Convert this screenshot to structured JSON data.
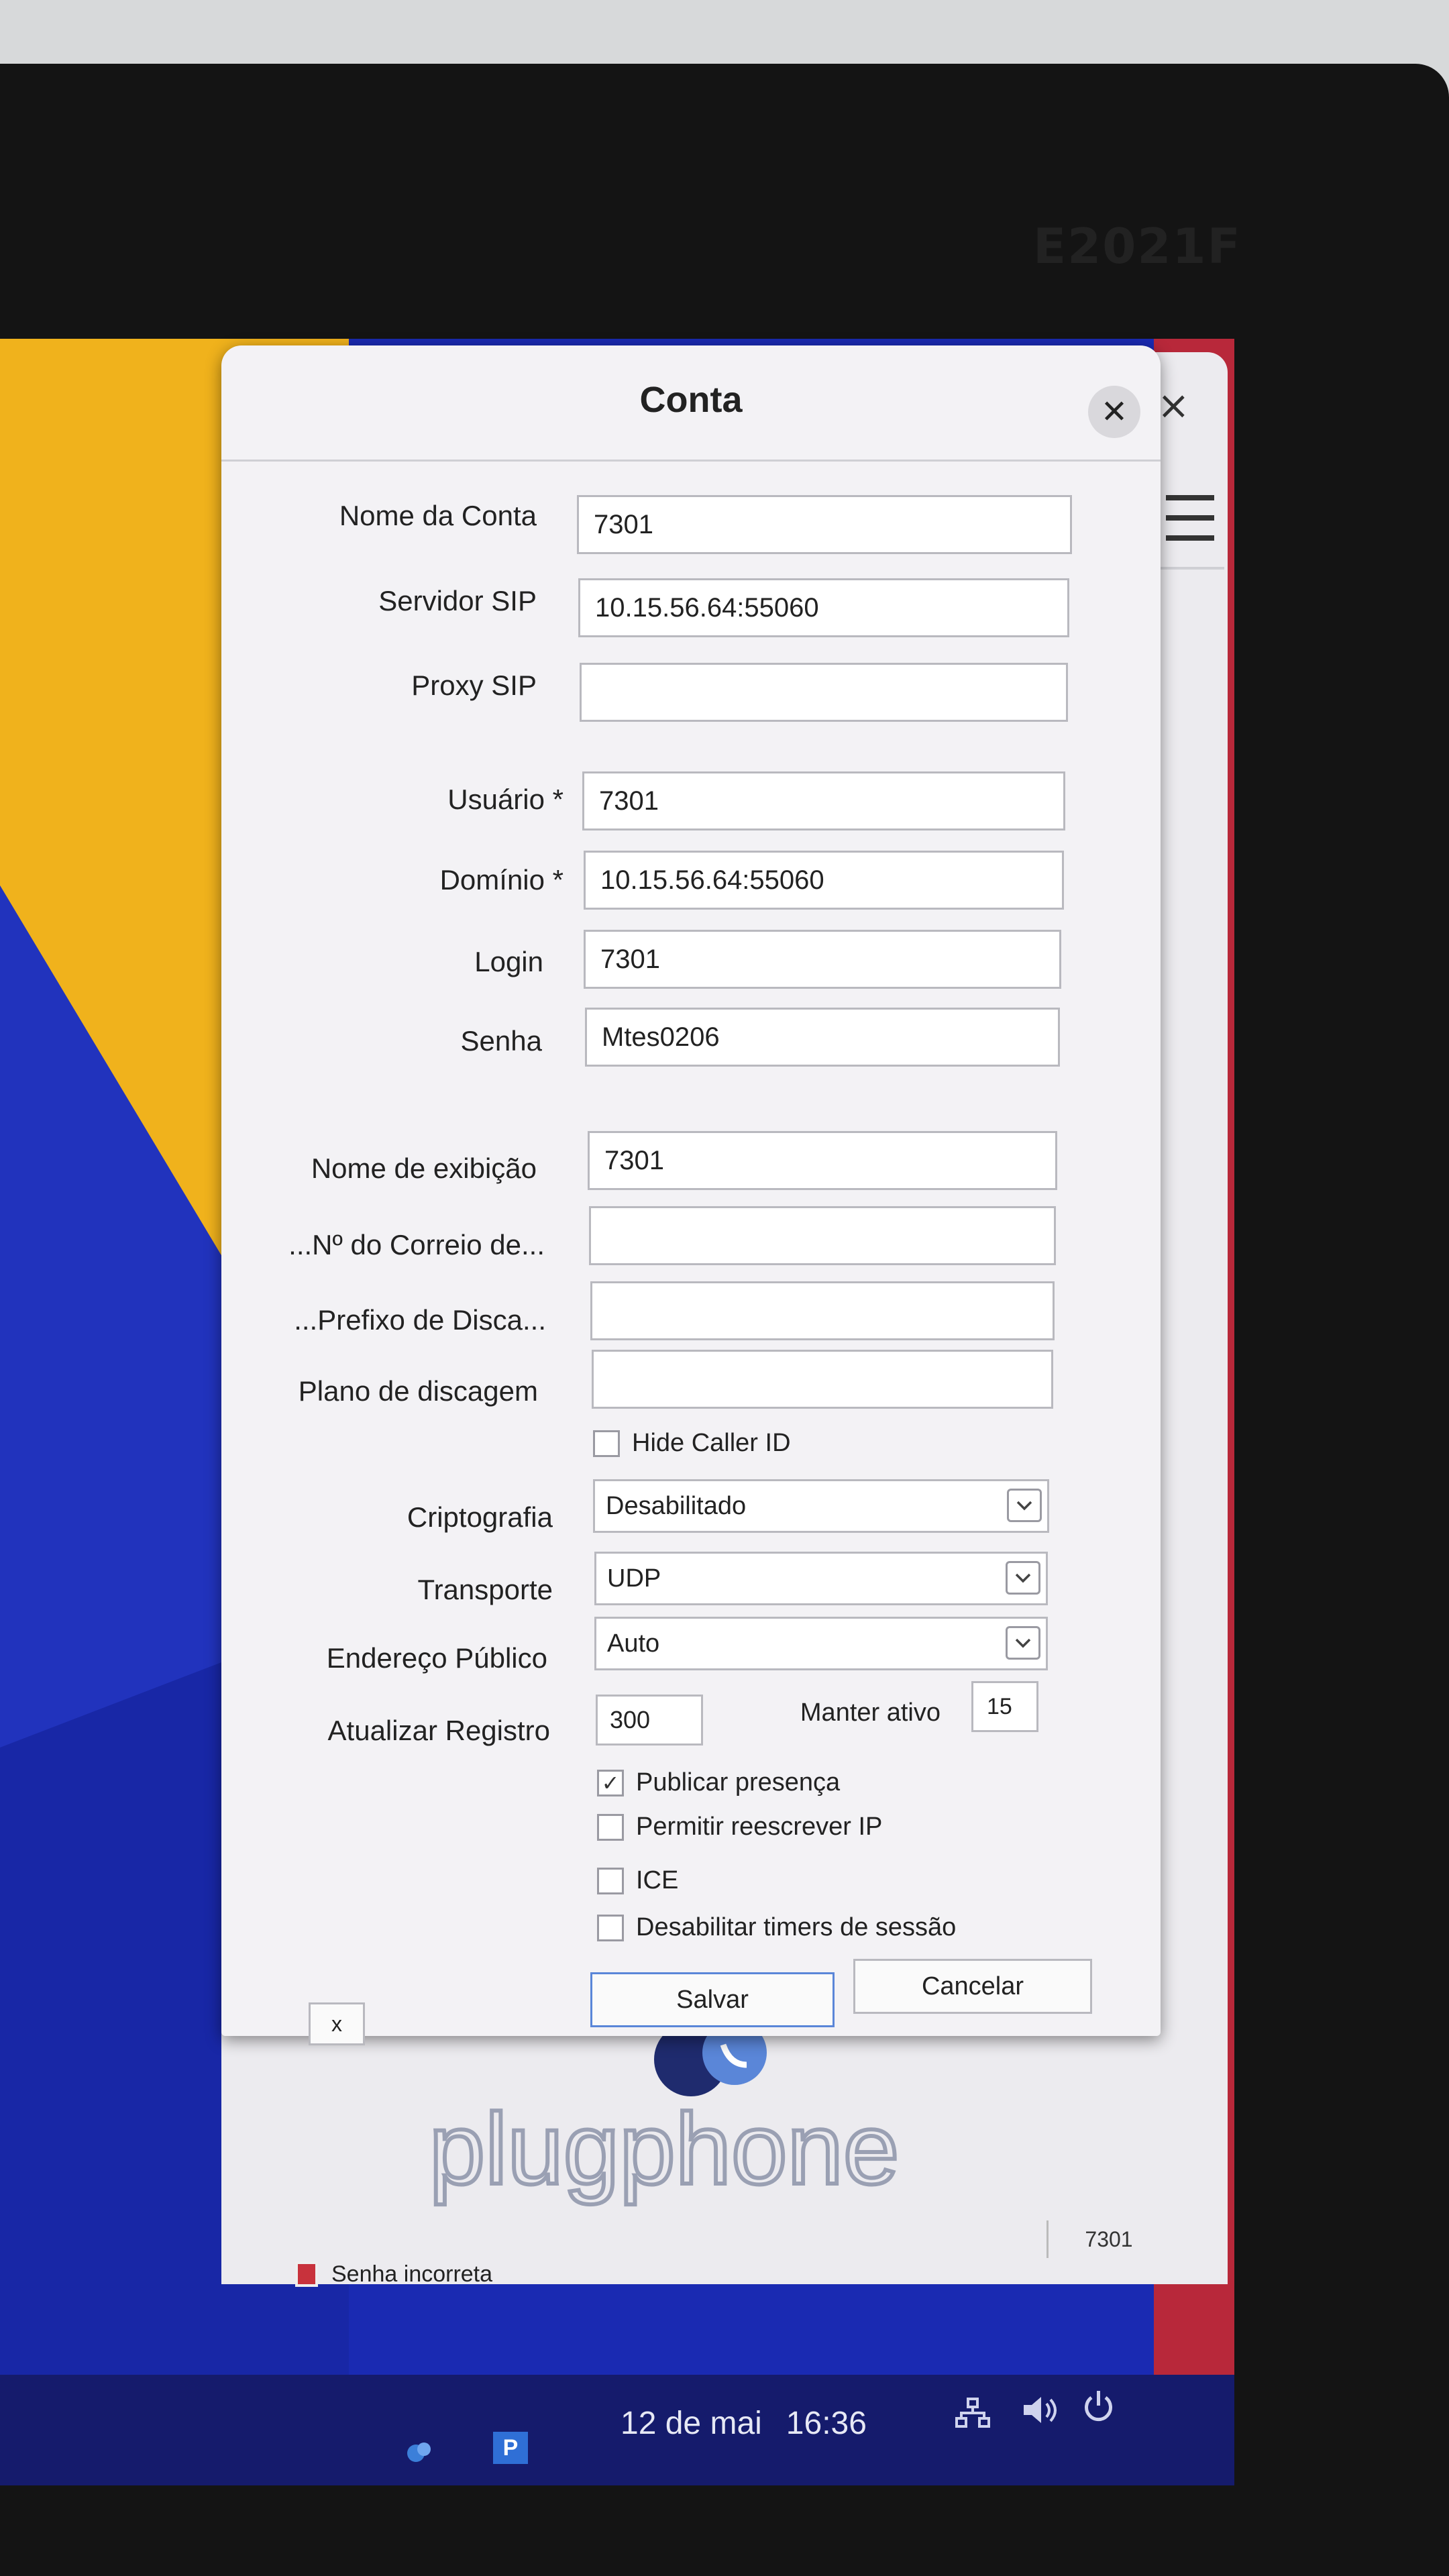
{
  "monitor": {
    "brand": "E2021F"
  },
  "dialog": {
    "title": "Conta",
    "close_glyph": "✕",
    "fields": [
      {
        "label": "Nome da Conta",
        "value": "7301"
      },
      {
        "label": "Servidor SIP",
        "value": "10.15.56.64:55060"
      },
      {
        "label": "Proxy SIP",
        "value": ""
      },
      {
        "label": "Usuário *",
        "value": "7301"
      },
      {
        "label": "Domínio *",
        "value": "10.15.56.64:55060"
      },
      {
        "label": "Login",
        "value": "7301"
      },
      {
        "label": "Senha",
        "value": "Mtes0206"
      },
      {
        "label": "Nome de exibição",
        "value": "7301"
      },
      {
        "label": "...Nº do Correio de...",
        "value": ""
      },
      {
        "label": "...Prefixo de Disca...",
        "value": ""
      },
      {
        "label": "Plano de discagem",
        "value": ""
      }
    ],
    "hide_caller_id": {
      "label": "Hide Caller ID",
      "checked": false
    },
    "selects": [
      {
        "label": "Criptografia",
        "value": "Desabilitado"
      },
      {
        "label": "Transporte",
        "value": "UDP"
      },
      {
        "label": "Endereço Público",
        "value": "Auto"
      }
    ],
    "register": {
      "label": "Atualizar Registro",
      "value": "300"
    },
    "keepalive": {
      "label": "Manter ativo",
      "value": "15"
    },
    "options": [
      {
        "label": "Publicar presença",
        "checked": true,
        "mark": "✓"
      },
      {
        "label": "Permitir reescrever IP",
        "checked": false,
        "mark": ""
      },
      {
        "label": "ICE",
        "checked": false,
        "mark": ""
      },
      {
        "label": "Desabilitar timers de sessão",
        "checked": false,
        "mark": ""
      }
    ],
    "small_button": "x",
    "save_label": "Salvar",
    "cancel_label": "Cancelar"
  },
  "main_window": {
    "close_glyph": "×",
    "logo_text": "plugphone",
    "account_badge": "7301",
    "status_text": "Senha incorreta"
  },
  "taskbar": {
    "app2_label": "P",
    "date": "12 de mai",
    "time": "16:36"
  },
  "icons": [
    "close-icon",
    "hamburger-menu-icon",
    "chevron-down-icon",
    "checkmark-icon",
    "network-icon",
    "volume-icon",
    "power-icon",
    "status-error-icon"
  ],
  "colors": {
    "accent_blue": "#5a86d8",
    "wallpaper_yellow": "#f0b21c",
    "wallpaper_blue": "#1a2ab2",
    "error_red": "#c8323c"
  }
}
